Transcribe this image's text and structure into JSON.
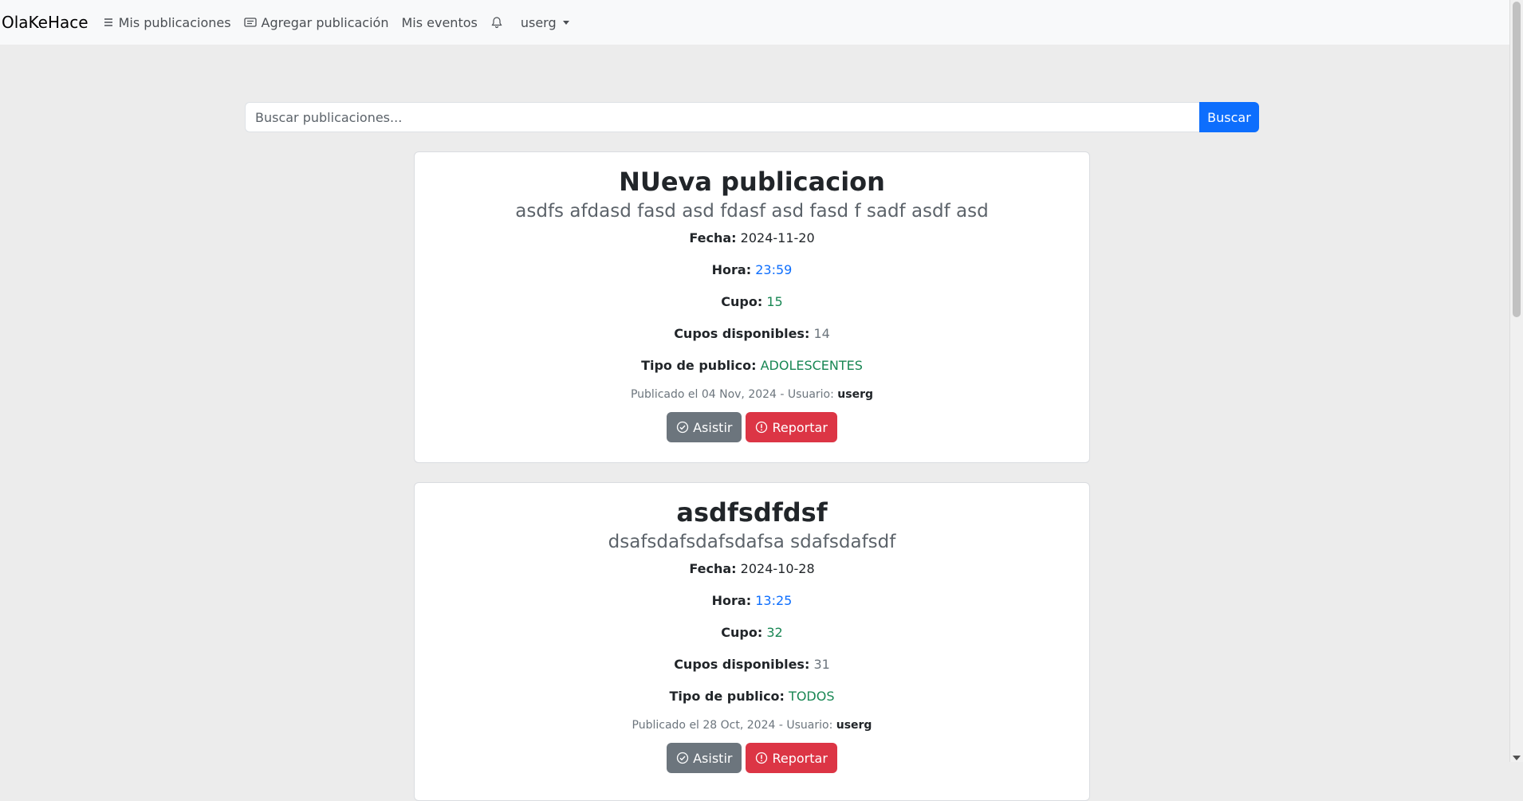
{
  "navbar": {
    "brand": "OlaKeHace",
    "links": [
      {
        "label": "Mis publicaciones",
        "icon": "list-icon"
      },
      {
        "label": "Agregar publicación",
        "icon": "card-text-icon"
      },
      {
        "label": "Mis eventos",
        "icon": ""
      }
    ],
    "user": "userg"
  },
  "search": {
    "placeholder": "Buscar publicaciones...",
    "button_label": "Buscar"
  },
  "labels": {
    "fecha": "Fecha:",
    "hora": "Hora:",
    "cupo": "Cupo:",
    "cupos_disponibles": "Cupos disponibles:",
    "tipo_publico": "Tipo de publico:",
    "usuario": "Usuario:",
    "asistir": "Asistir",
    "reportar": "Reportar"
  },
  "publicaciones": [
    {
      "title": "NUeva publicacion",
      "subtitle": "asdfs afdasd fasd asd fdasf asd fasd f sadf asdf asd",
      "fecha": "2024-11-20",
      "hora": "23:59",
      "cupo": "15",
      "cupos_disponibles": "14",
      "tipo_publico": "ADOLESCENTES",
      "publicado": "Publicado el 04 Nov, 2024 - ",
      "usuario": "userg"
    },
    {
      "title": "asdfsdfdsf",
      "subtitle": "dsafsdafsdafsdafsa sdafsdafsdf",
      "fecha": "2024-10-28",
      "hora": "13:25",
      "cupo": "32",
      "cupos_disponibles": "31",
      "tipo_publico": "TODOS",
      "publicado": "Publicado el 28 Oct, 2024 - ",
      "usuario": "userg"
    }
  ],
  "colors": {
    "primary": "#0d6efd",
    "success": "#198754",
    "secondary": "#6c757d",
    "danger": "#dc3545"
  }
}
